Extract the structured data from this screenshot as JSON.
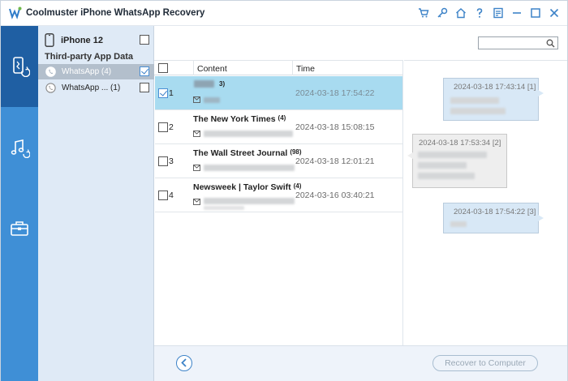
{
  "app": {
    "title": "Coolmuster iPhone WhatsApp Recovery",
    "brand_color": "#3f8fd6",
    "titlebar_icons": [
      "cart-icon",
      "key-icon",
      "home-icon",
      "help-icon",
      "feedback-icon",
      "minimize-icon",
      "maximize-icon",
      "close-icon"
    ]
  },
  "rail": {
    "items": [
      {
        "icon": "phone-sync-icon",
        "active": true
      },
      {
        "icon": "music-sync-icon",
        "active": false
      },
      {
        "icon": "toolbox-icon",
        "active": false
      }
    ]
  },
  "device": {
    "name": "iPhone 12",
    "section_label": "Third-party App Data",
    "apps": [
      {
        "label": "WhatsApp   (4)",
        "selected": true,
        "checked": true
      },
      {
        "label": "WhatsApp ...   (1)",
        "selected": false,
        "checked": false
      }
    ]
  },
  "list": {
    "columns": {
      "content": "Content",
      "time": "Time"
    },
    "rows": [
      {
        "index": "1",
        "title": "",
        "count": "3)",
        "time": "2024-03-18 17:54:22",
        "checked": true,
        "selected": true
      },
      {
        "index": "2",
        "title": "The New York Times",
        "count": "(4)",
        "time": "2024-03-18 15:08:15",
        "checked": false,
        "selected": false
      },
      {
        "index": "3",
        "title": "The Wall Street Journal",
        "count": "(98)",
        "time": "2024-03-18 12:01:21",
        "checked": false,
        "selected": false
      },
      {
        "index": "4",
        "title": "Newsweek | Taylor Swift",
        "count": "(4)",
        "time": "2024-03-16 03:40:21",
        "checked": false,
        "selected": false
      }
    ]
  },
  "chat": {
    "search_placeholder": "",
    "messages": [
      {
        "time": "2024-03-18 17:43:14  [1]",
        "side": "right"
      },
      {
        "time": "2024-03-18 17:53:34  [2]",
        "side": "left"
      },
      {
        "time": "2024-03-18 17:54:22  [3]",
        "side": "right"
      }
    ]
  },
  "footer": {
    "recover_label": "Recover to Computer"
  }
}
